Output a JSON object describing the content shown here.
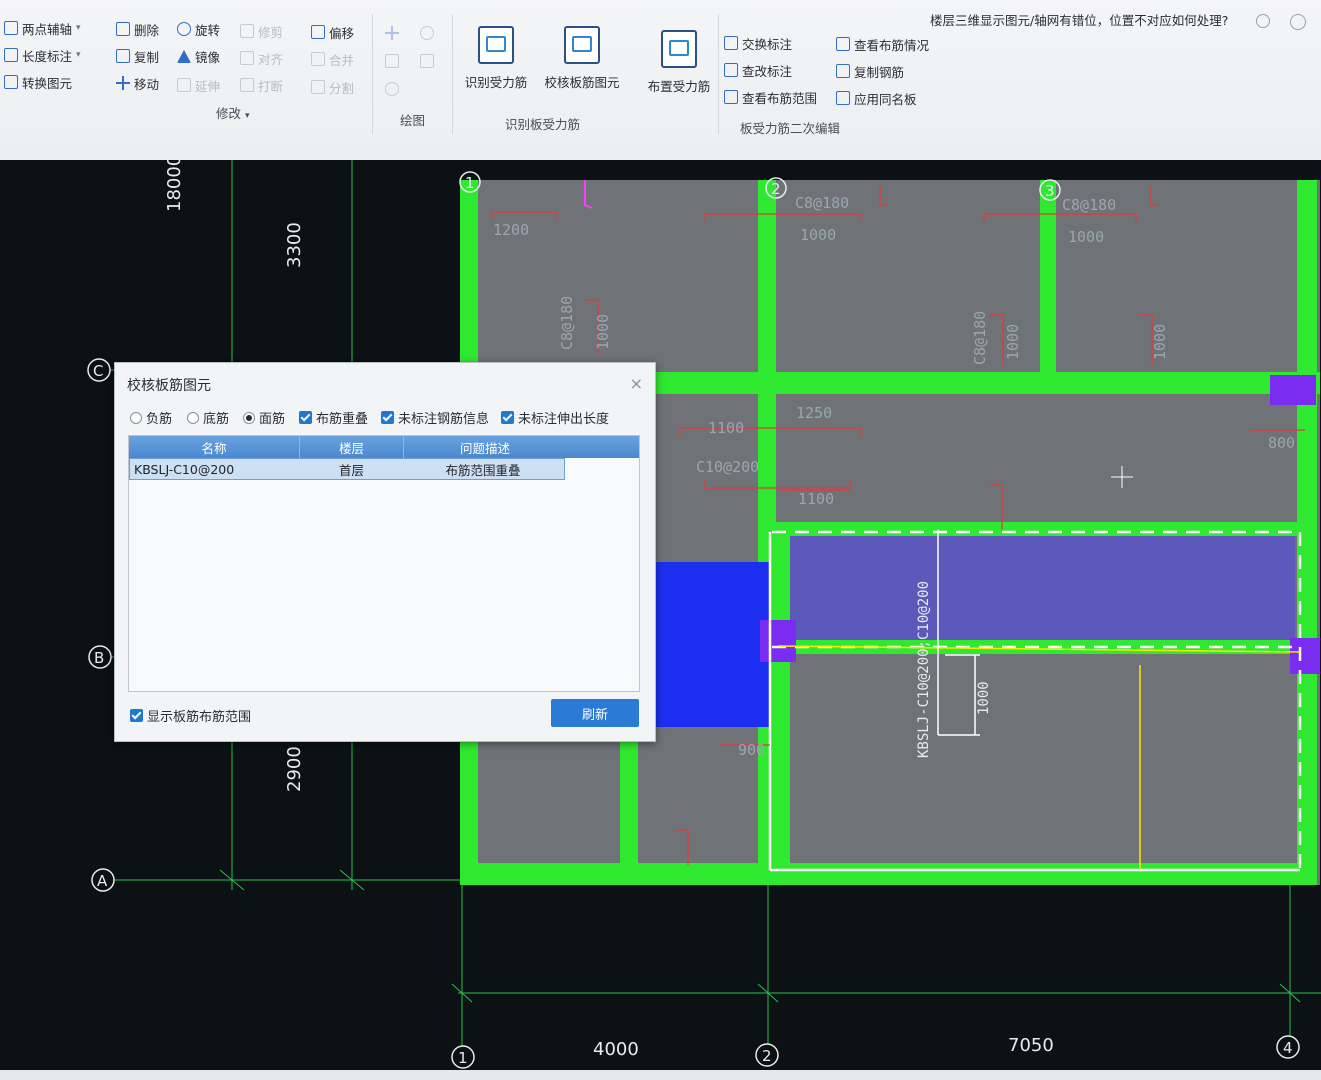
{
  "ribbon": {
    "help_question": "楼层三维显示图元/轴网有错位，位置不对应如何处理?",
    "axis_tools": [
      "两点辅轴",
      "长度标注",
      "转换图元"
    ],
    "modify_col1": [
      "删除",
      "复制",
      "移动"
    ],
    "modify_col2": [
      "旋转",
      "镜像",
      "延伸"
    ],
    "modify_col3": [
      "修剪",
      "对齐",
      "打断"
    ],
    "modify_col4": [
      "偏移",
      "合并",
      "分割"
    ],
    "big_buttons": [
      "识别受力筋",
      "校核板筋图元",
      "布置受力筋"
    ],
    "edit_col1": [
      "交换标注",
      "查改标注",
      "查看布筋范围"
    ],
    "edit_col2": [
      "查看布筋情况",
      "复制钢筋",
      "应用同名板"
    ],
    "groups": {
      "modify": "修改",
      "draw": "绘图",
      "recognize": "识别板受力筋",
      "secondary_edit": "板受力筋二次编辑"
    }
  },
  "canvas": {
    "axis_letters": [
      "C",
      "B",
      "A"
    ],
    "axis_numbers_top": [
      "1",
      "2",
      "3"
    ],
    "axis_numbers_bottom": [
      "1",
      "2",
      "4"
    ],
    "dims_vertical": [
      "18000",
      "3300",
      "2900"
    ],
    "dims_horizontal": [
      "4000",
      "7050"
    ],
    "tags": {
      "c8_a": "C8@180",
      "c8_b": "C8@180",
      "c8_c": "C8@180",
      "c8_d": "C8@180",
      "c10_200": "C10@200",
      "n1200": "1200",
      "n1000_a": "1000",
      "n1000_b": "1000",
      "n1000_c": "1000",
      "n1000_d": "1000",
      "n1000_e": "1000",
      "n1250": "1250",
      "n1100_a": "1100",
      "n1100_b": "1100",
      "n800": "800",
      "n900": "900",
      "kbslj_vert": "KBSLJ-C10@200;C10@200",
      "dim1000_vert": "1000"
    }
  },
  "dialog": {
    "title": "校核板筋图元",
    "radios": [
      {
        "label": "负筋",
        "checked": false
      },
      {
        "label": "底筋",
        "checked": false
      },
      {
        "label": "面筋",
        "checked": true
      }
    ],
    "checks": [
      "布筋重叠",
      "未标注钢筋信息",
      "未标注伸出长度"
    ],
    "columns": [
      "名称",
      "楼层",
      "问题描述"
    ],
    "row": {
      "name": "KBSLJ-C10@200",
      "floor": "首层",
      "issue": "布筋范围重叠"
    },
    "show_range_label": "显示板筋布筋范围",
    "refresh_label": "刷新"
  },
  "colors": {
    "beam_green": "#2fe830",
    "slab_gray": "#6f7276",
    "slab_blue": "#5a55c8",
    "blue_fill": "#1c2ff0",
    "red_line": "#e23b3b",
    "accent_blue": "#2b7bd6"
  }
}
